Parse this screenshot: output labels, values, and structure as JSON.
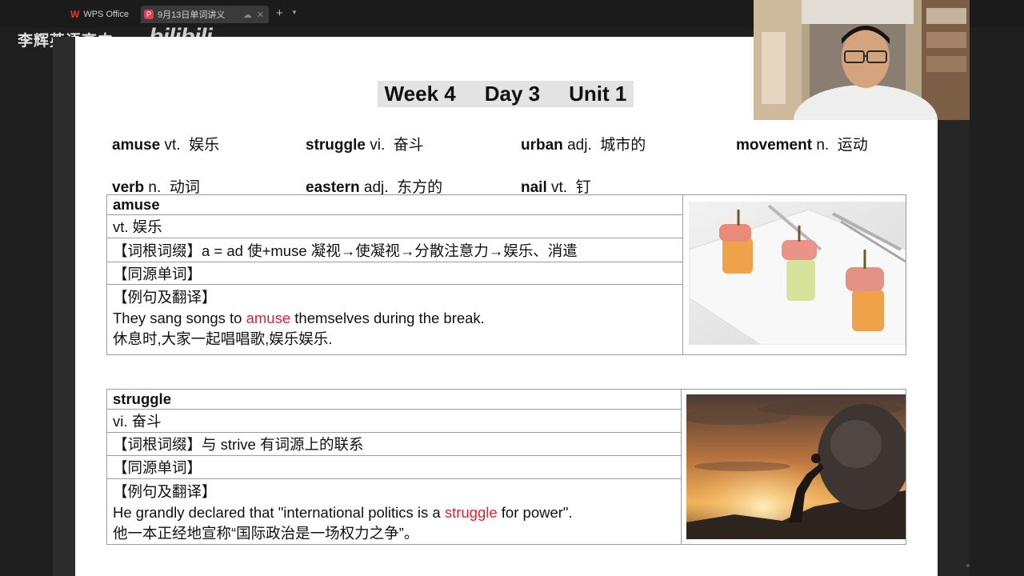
{
  "tabs": {
    "app_label": "WPS Office",
    "doc_label": "9月13日单词讲义"
  },
  "watermark": {
    "channel": "李辉英语高中",
    "site": "bilibili"
  },
  "title": {
    "week": "Week 4",
    "day": "Day 3",
    "unit": "Unit 1"
  },
  "vocab_list": [
    {
      "word": "amuse",
      "pos": "vt.",
      "meaning": "娱乐"
    },
    {
      "word": "struggle",
      "pos": "vi.",
      "meaning": "奋斗"
    },
    {
      "word": "urban",
      "pos": "adj.",
      "meaning": "城市的"
    },
    {
      "word": "movement",
      "pos": "n.",
      "meaning": "运动"
    },
    {
      "word": "verb",
      "pos": "n.",
      "meaning": "动词"
    },
    {
      "word": "eastern",
      "pos": "adj.",
      "meaning": "东方的"
    },
    {
      "word": "nail",
      "pos": "vt.",
      "meaning": "钉"
    }
  ],
  "entries": [
    {
      "word": "amuse",
      "definition": "vt.  娱乐",
      "etymology": "【词根词缀】a = ad 使+muse 凝视→使凝视→分散注意力→娱乐、消遣",
      "cognates": "【同源单词】",
      "examples_label": "【例句及翻译】",
      "example_before": "They sang songs to ",
      "example_highlight": "amuse",
      "example_after": " themselves during the break.",
      "translation": "休息时,大家一起唱唱歌,娱乐娱乐."
    },
    {
      "word": "struggle",
      "definition": "vi.  奋斗",
      "etymology": "【词根词缀】与  strive  有词源上的联系",
      "cognates": "【同源单词】",
      "examples_label": "【例句及翻译】",
      "example_before": "He grandly declared that \"international politics is a ",
      "example_highlight": "struggle",
      "example_after": " for power\".",
      "translation": "他一本正经地宣称“国际政治是一场权力之争”。"
    }
  ],
  "colors": {
    "highlight": "#e0202e",
    "title_bg": "#e3e3e3",
    "app_bg": "#1f1f1f"
  }
}
